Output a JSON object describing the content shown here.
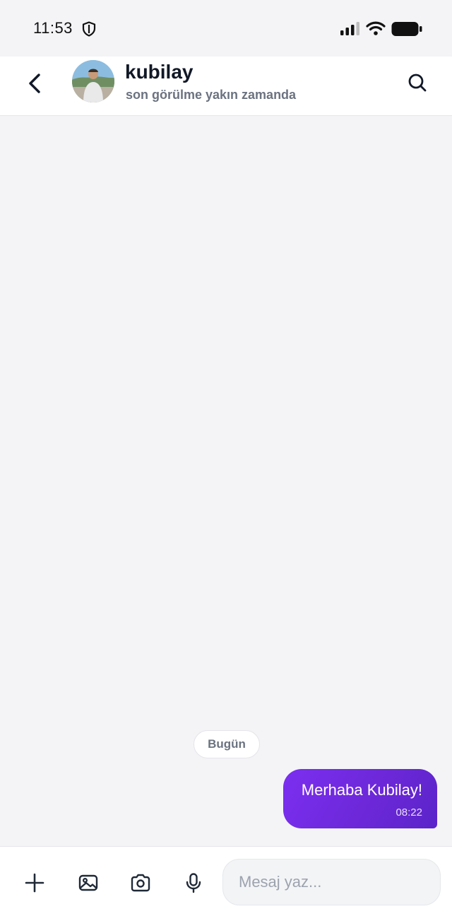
{
  "status_bar": {
    "time": "11:53"
  },
  "header": {
    "contact_name": "kubilay",
    "contact_status": "son görülme yakın zamanda"
  },
  "chat": {
    "date_separator": "Bugün",
    "messages": [
      {
        "direction": "outgoing",
        "text": "Merhaba Kubilay!",
        "time": "08:22"
      }
    ]
  },
  "composer": {
    "placeholder": "Mesaj yaz...",
    "value": ""
  },
  "colors": {
    "accent": "#6d28d9",
    "background": "#f4f4f7"
  },
  "icons": [
    "shield-icon",
    "signal-icon",
    "wifi-icon",
    "battery-icon",
    "back-arrow-icon",
    "search-icon",
    "plus-icon",
    "image-icon",
    "camera-icon",
    "microphone-icon"
  ]
}
